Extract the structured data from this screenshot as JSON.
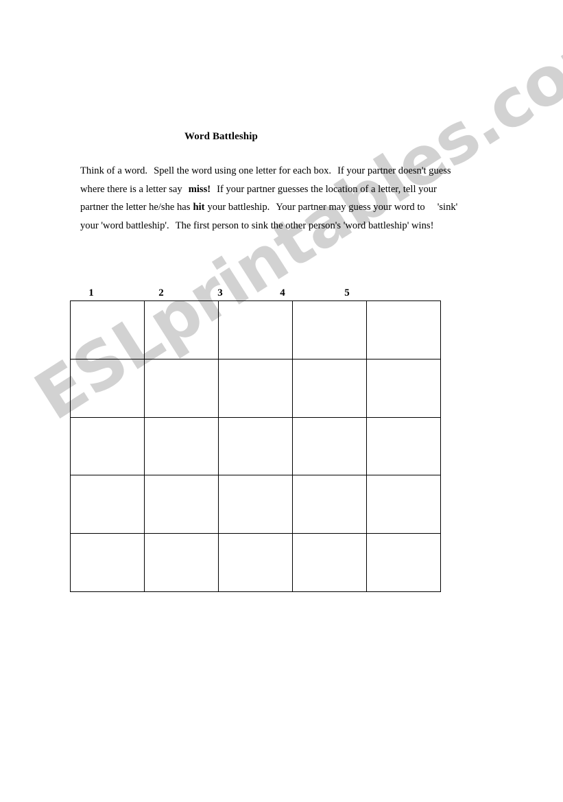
{
  "document": {
    "title": "Word Battleship",
    "instructions": {
      "line1_a": "Think of  a word.",
      "line1_b": "Spell the word using one letter for each box.",
      "line1_c": "If your partner doesn't guess",
      "line2_a": "where  there  is  a  letter  say",
      "line2_bold": "miss!",
      "line2_b": "If  your  partner  guesses  the  location of  a  letter,  tell  your",
      "line3_a": "partner the letter he/she has",
      "line3_bold": "hit",
      "line3_b": "your battleship.",
      "line3_c": "Your partner may guess your word to",
      "line3_d": "'sink'",
      "line4_a": "your 'word battleship'.",
      "line4_b": "The first person to sink the other person's 'word battleship' wins!"
    },
    "grid": {
      "column_headers": [
        "1",
        "2",
        "3",
        "4",
        "5"
      ],
      "rows": 5,
      "columns": 5,
      "cells": [
        [
          "",
          "",
          "",
          "",
          ""
        ],
        [
          "",
          "",
          "",
          "",
          ""
        ],
        [
          "",
          "",
          "",
          "",
          ""
        ],
        [
          "",
          "",
          "",
          "",
          ""
        ],
        [
          "",
          "",
          "",
          "",
          ""
        ]
      ]
    },
    "watermark": {
      "text": "ESLprintables.com",
      "color": "#d2d2d2"
    },
    "colors": {
      "page_background": "#ffffff",
      "text": "#000000",
      "grid_line": "#000000",
      "watermark": "#d2d2d2"
    }
  }
}
